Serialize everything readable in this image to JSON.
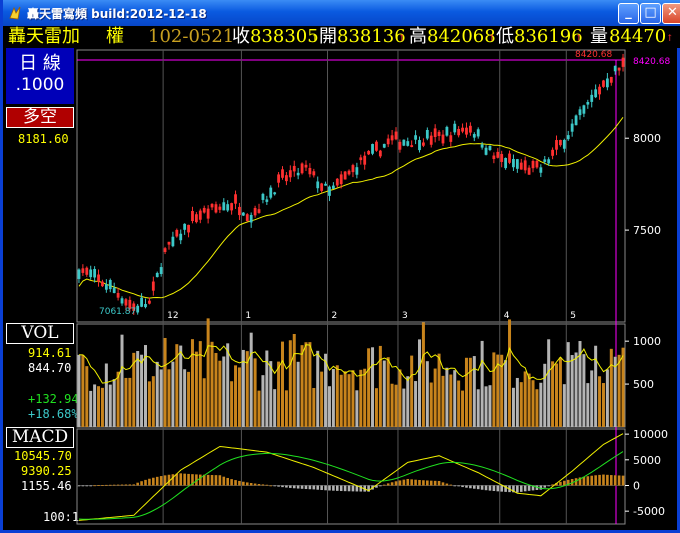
{
  "window": {
    "title": "轟天雷寫頻 build:2012-12-18",
    "buttons": {
      "minimize": "_",
      "maximize": "□",
      "close": "✕"
    }
  },
  "quote": {
    "name": "轟天雷加",
    "type": "權",
    "date": "102-0521",
    "close_label": "收",
    "close_value": "838305",
    "open_label": "開",
    "open_value": "838136",
    "high_label": "高",
    "high_value": "842068",
    "low_label": "低",
    "low_value": "836196",
    "volume_label": "量",
    "volume_value": "84470",
    "arrow": "↑"
  },
  "sidebar": {
    "period_label": "日 線",
    "multiplier": ".1000",
    "indicator_label": "多空",
    "indicator_value": "8181.60",
    "vol_label": "VOL",
    "vol_value1": "914.61",
    "vol_value2": "844.70",
    "vol_change": "+132.94",
    "vol_change_pct": "+18.68%",
    "macd_label": "MACD",
    "macd_value1": "10545.70",
    "macd_value2": "9390.25",
    "macd_value3": "1155.46",
    "ratio": "100:1"
  },
  "colors": {
    "up": "#ff3030",
    "down": "#3cc8c8",
    "vol_up": "#c8841c",
    "vol_down": "#b4b4b4",
    "ma": "#f0f000",
    "macd_fast": "#f0f000",
    "macd_slow": "#20e020",
    "grid": "#555555",
    "magenta": "#ff00ff"
  },
  "chart_data": [
    {
      "type": "candlestick",
      "title": "",
      "x_ticks": [
        "12",
        "1",
        "2",
        "3",
        "4",
        "5"
      ],
      "y_ticks": [
        7500,
        8000
      ],
      "ylim": [
        7000,
        8480
      ],
      "high_label": "8420.68",
      "low_label": "7061.87",
      "last_label": "8420.68",
      "grid": true
    },
    {
      "type": "bar",
      "title": "VOL",
      "y_ticks": [
        500,
        1000
      ],
      "ylim": [
        0,
        1200
      ],
      "grid": true
    },
    {
      "type": "bar+line",
      "title": "MACD",
      "y_ticks": [
        -5000,
        0,
        5000,
        10000
      ],
      "ylim": [
        -7500,
        11000
      ],
      "grid": true
    }
  ]
}
